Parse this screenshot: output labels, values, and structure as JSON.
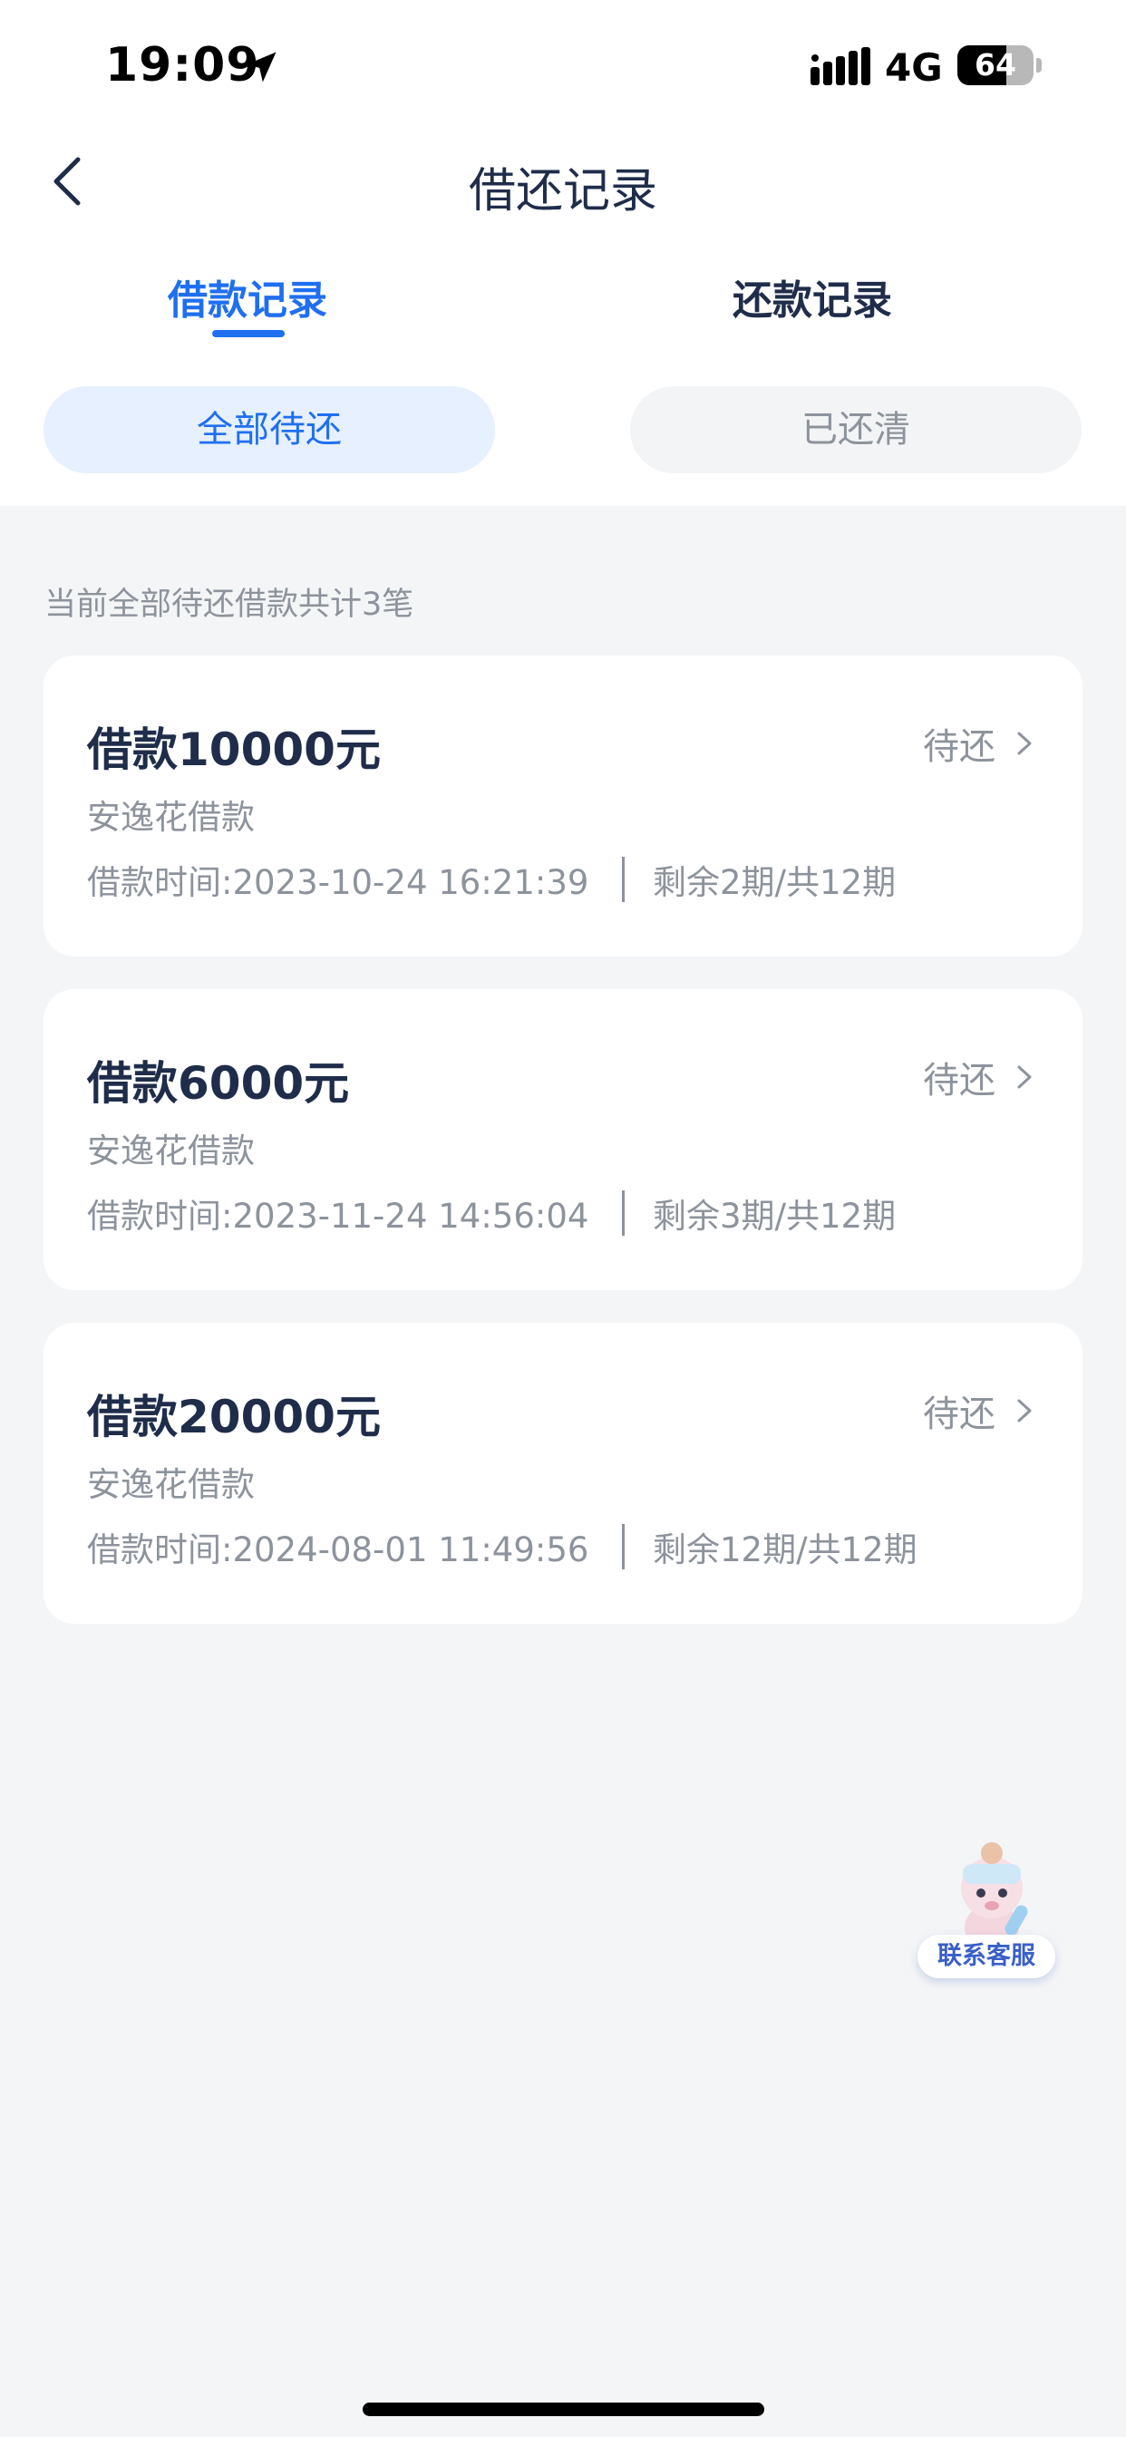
{
  "status_bar": {
    "time": "19:09",
    "network": "4G",
    "battery": "64",
    "battery_level": 0.64
  },
  "nav": {
    "title": "借还记录",
    "back_icon": "chevron-left-icon"
  },
  "tabs": [
    {
      "label": "借款记录",
      "active": true
    },
    {
      "label": "还款记录",
      "active": false
    }
  ],
  "filters": [
    {
      "label": "全部待还",
      "active": true
    },
    {
      "label": "已还清",
      "active": false
    }
  ],
  "summary": "当前全部待还借款共计3笔",
  "loans": [
    {
      "amount": "借款10000元",
      "status": "待还",
      "product": "安逸花借款",
      "time": "借款时间:2023-10-24 16:21:39",
      "periods": "剩余2期/共12期"
    },
    {
      "amount": "借款6000元",
      "status": "待还",
      "product": "安逸花借款",
      "time": "借款时间:2023-11-24 14:56:04",
      "periods": "剩余3期/共12期"
    },
    {
      "amount": "借款20000元",
      "status": "待还",
      "product": "安逸花借款",
      "time": "借款时间:2024-08-01 11:49:56",
      "periods": "剩余12期/共12期"
    }
  ],
  "customer_service": {
    "label": "联系客服",
    "icon": "mascot-icon"
  },
  "colors": {
    "accent": "#1f6ff0",
    "accent_bg": "#e6f0fe",
    "text_primary": "#1f2d4a",
    "text_secondary": "#8d939c",
    "page_bg": "#f4f5f7"
  }
}
